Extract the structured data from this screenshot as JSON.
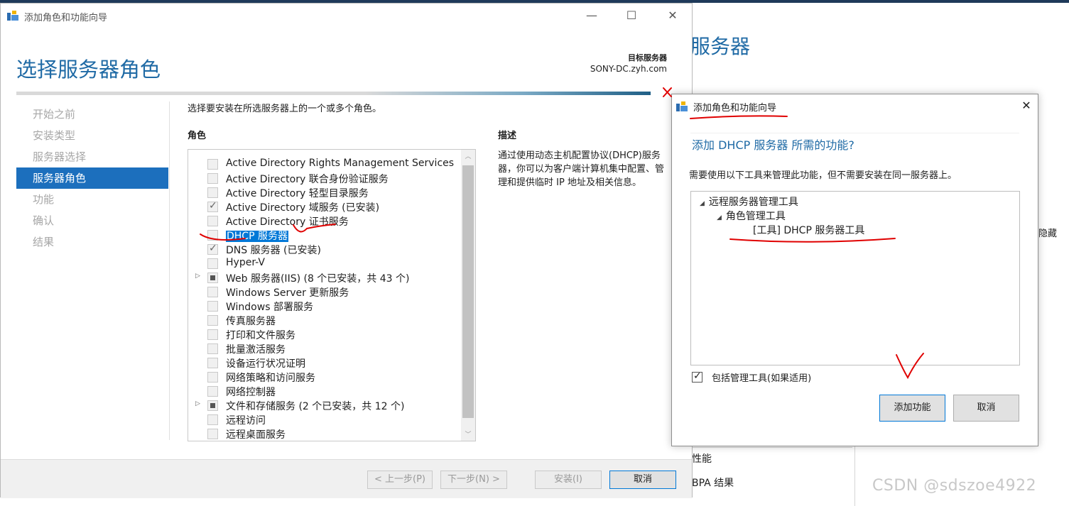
{
  "background": {
    "title": "服务器",
    "hide_text": "隐藏",
    "performance": "性能",
    "bpa": "BPA 结果"
  },
  "watermark": "CSDN @sdszoe4922",
  "wizard": {
    "title": "添加角色和功能向导",
    "page_title": "选择服务器角色",
    "target_label": "目标服务器",
    "target_value": "SONY-DC.zyh.com",
    "nav": [
      "开始之前",
      "安装类型",
      "服务器选择",
      "服务器角色",
      "功能",
      "确认",
      "结果"
    ],
    "nav_active_index": 3,
    "instruction": "选择要安装在所选服务器上的一个或多个角色。",
    "roles_heading": "角色",
    "desc_heading": "描述",
    "description": "通过使用动态主机配置协议(DHCP)服务器，你可以为客户端计算机集中配置、管理和提供临时 IP 地址及相关信息。",
    "roles": [
      {
        "label": "Active Directory Rights Management Services",
        "state": "unchecked",
        "expander": false
      },
      {
        "label": "Active Directory 联合身份验证服务",
        "state": "unchecked",
        "expander": false
      },
      {
        "label": "Active Directory 轻型目录服务",
        "state": "unchecked",
        "expander": false
      },
      {
        "label": "Active Directory 域服务 (已安装)",
        "state": "checked",
        "expander": false
      },
      {
        "label": "Active Directory 证书服务",
        "state": "unchecked",
        "expander": false
      },
      {
        "label": "DHCP 服务器",
        "state": "unchecked",
        "expander": false,
        "selected": true
      },
      {
        "label": "DNS 服务器 (已安装)",
        "state": "checked",
        "expander": false
      },
      {
        "label": "Hyper-V",
        "state": "unchecked",
        "expander": false
      },
      {
        "label": "Web 服务器(IIS) (8 个已安装，共 43 个)",
        "state": "partial",
        "expander": true
      },
      {
        "label": "Windows Server 更新服务",
        "state": "unchecked",
        "expander": false
      },
      {
        "label": "Windows 部署服务",
        "state": "unchecked",
        "expander": false
      },
      {
        "label": "传真服务器",
        "state": "unchecked",
        "expander": false
      },
      {
        "label": "打印和文件服务",
        "state": "unchecked",
        "expander": false
      },
      {
        "label": "批量激活服务",
        "state": "unchecked",
        "expander": false
      },
      {
        "label": "设备运行状况证明",
        "state": "unchecked",
        "expander": false
      },
      {
        "label": "网络策略和访问服务",
        "state": "unchecked",
        "expander": false
      },
      {
        "label": "网络控制器",
        "state": "unchecked",
        "expander": false
      },
      {
        "label": "文件和存储服务 (2 个已安装，共 12 个)",
        "state": "partial",
        "expander": true
      },
      {
        "label": "远程访问",
        "state": "unchecked",
        "expander": false
      },
      {
        "label": "远程桌面服务",
        "state": "unchecked",
        "expander": false
      }
    ],
    "buttons": {
      "prev": "< 上一步(P)",
      "next": "下一步(N) >",
      "install": "安装(I)",
      "cancel": "取消"
    }
  },
  "popup": {
    "title": "添加角色和功能向导",
    "heading": "添加 DHCP 服务器 所需的功能?",
    "description": "需要使用以下工具来管理此功能，但不需要安装在同一服务器上。",
    "tree": [
      {
        "label": "远程服务器管理工具",
        "level": 0,
        "arrow": "◢"
      },
      {
        "label": "角色管理工具",
        "level": 1,
        "arrow": "◢"
      },
      {
        "label": "[工具] DHCP 服务器工具",
        "level": 2,
        "arrow": ""
      }
    ],
    "include_tools_label": "包括管理工具(如果适用)",
    "include_tools_checked": true,
    "add_button": "添加功能",
    "cancel_button": "取消"
  },
  "icons": {
    "window_minimize": "—",
    "window_maximize": "☐",
    "window_close": "✕",
    "scroll_up": "︿",
    "scroll_down": "﹀",
    "expander": "▷"
  },
  "colors": {
    "accent_blue": "#1f6aa5",
    "nav_active": "#1c6fbd",
    "selection": "#0078d7",
    "annotation_red": "#e00000"
  }
}
